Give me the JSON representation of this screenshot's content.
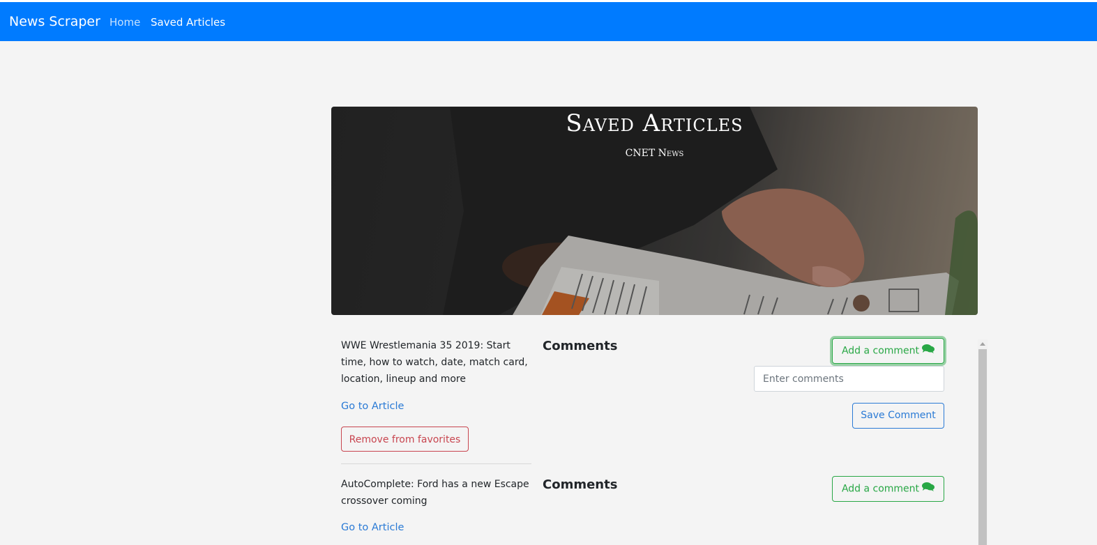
{
  "navbar": {
    "brand": "News Scraper",
    "links": [
      "Home",
      "Saved Articles"
    ],
    "color": "#007bff"
  },
  "hero": {
    "title": "Saved Articles",
    "subtitle": "CNET News"
  },
  "articles": [
    {
      "title": "WWE Wrestlemania 35 2019: Start time, how to watch, date, match card, location, lineup and more",
      "link_label": "Go to Article",
      "remove_label": "Remove from favorites",
      "comments_heading": "Comments",
      "add_comment_label": "Add a comment",
      "comment_placeholder": "Enter comments",
      "save_label": "Save Comment"
    },
    {
      "title": "AutoComplete: Ford has a new Escape crossover coming",
      "link_label": "Go to Article",
      "comments_heading": "Comments",
      "add_comment_label": "Add a comment"
    }
  ],
  "colors": {
    "success": "#28a745",
    "danger": "#c8454f",
    "link": "#2a7ad5"
  },
  "icons": [
    "comments-icon",
    "scroll-up-arrow-icon"
  ]
}
